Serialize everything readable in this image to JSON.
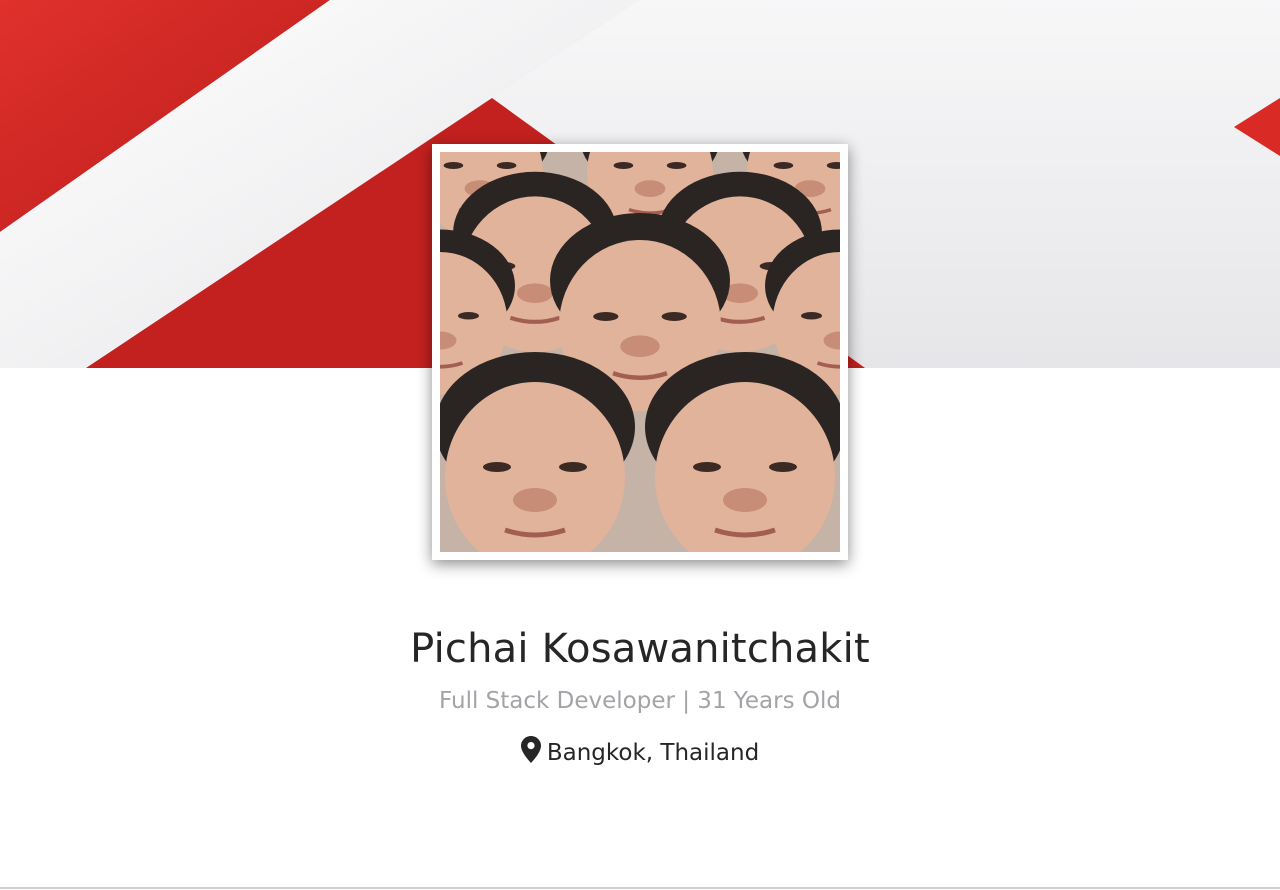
{
  "profile": {
    "name": "Pichai Kosawanitchakit",
    "subtitle": "Full Stack Developer | 31 Years Old",
    "location": "Bangkok, Thailand",
    "location_icon": "map-marker-icon"
  },
  "colors": {
    "accent_red": "#c8201f",
    "accent_red_light": "#e0312c",
    "text_dark": "#262626",
    "text_muted": "#a3a3a8"
  }
}
